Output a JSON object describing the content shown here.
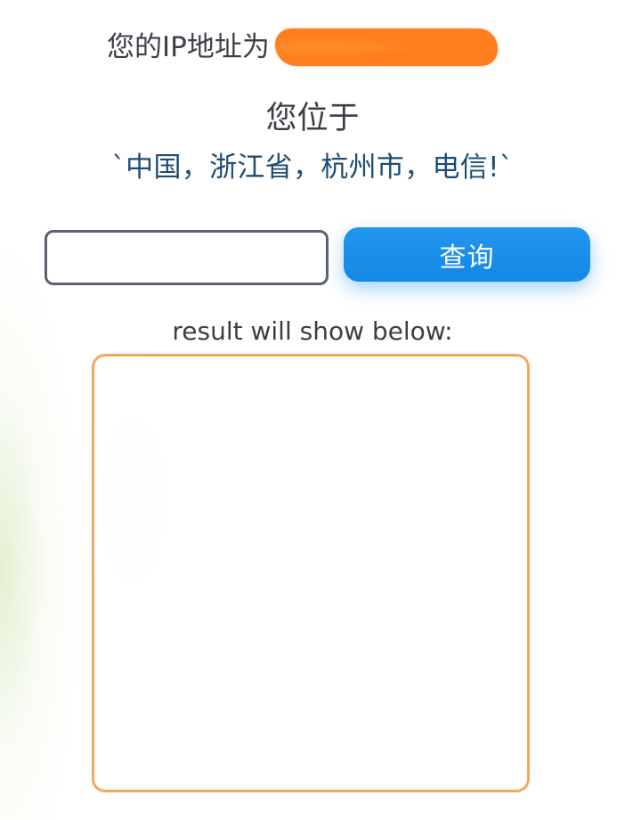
{
  "header": {
    "ip_prefix": "您的IP地址为",
    "ip_value": ""
  },
  "location": {
    "label": "您位于",
    "value": "`中国，浙江省，杭州市，电信!`"
  },
  "search": {
    "input_value": "",
    "placeholder": "",
    "button_label": "查询"
  },
  "result": {
    "label": "result will show below:",
    "content": ""
  },
  "colors": {
    "button": "#1487E6",
    "result_border": "#F4A85F",
    "location_text": "#1E4D73",
    "redaction": "#FF7D1C"
  }
}
